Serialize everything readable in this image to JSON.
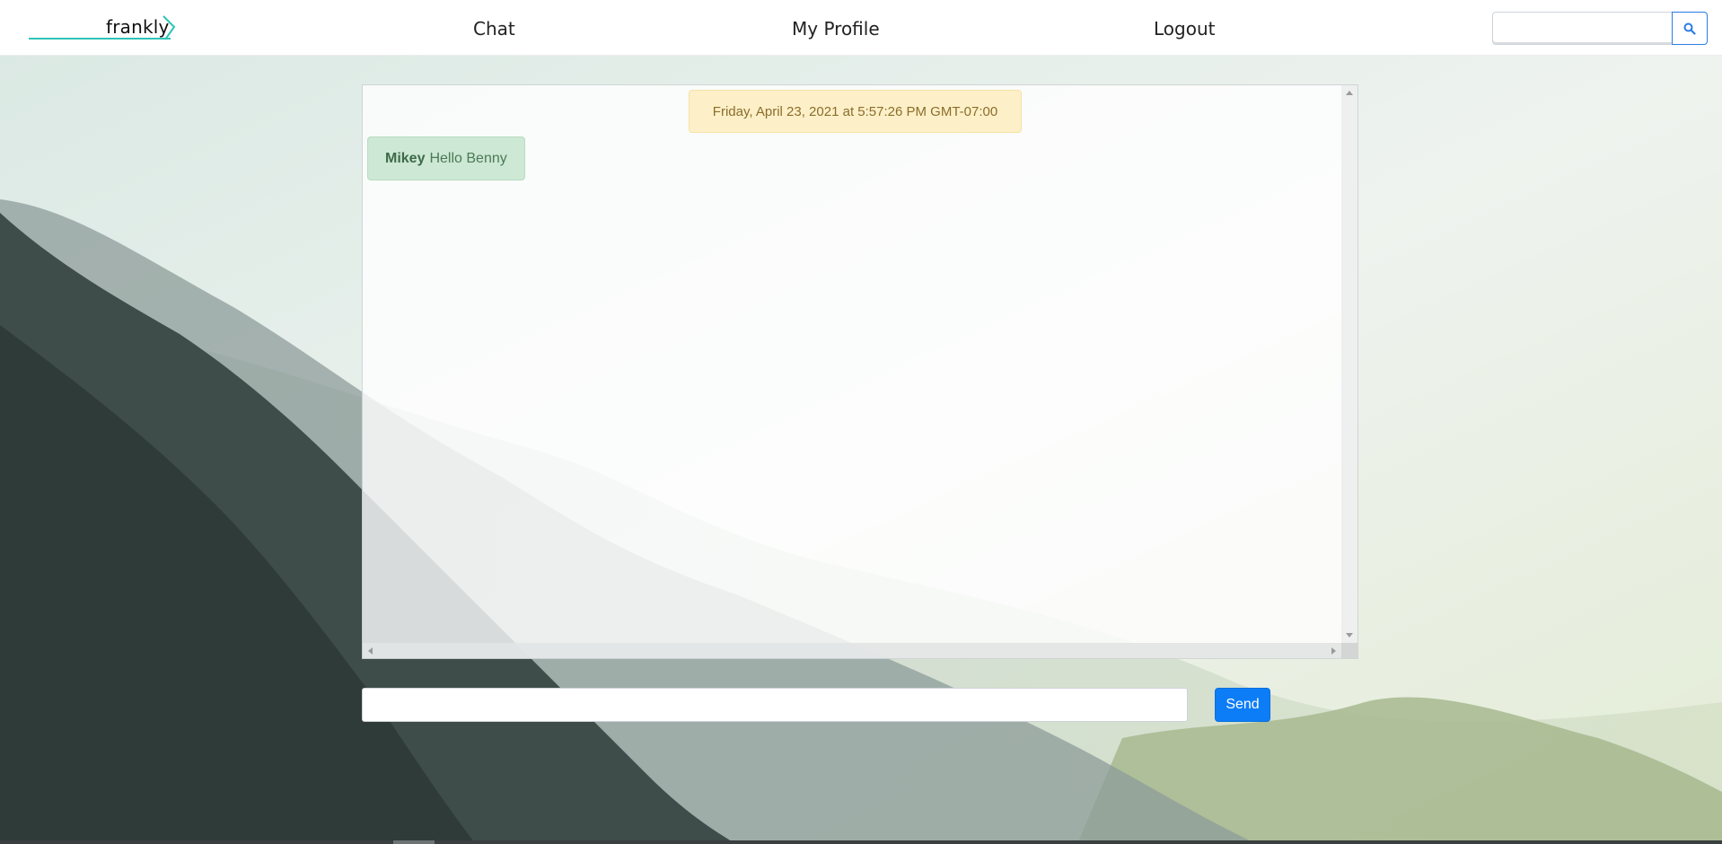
{
  "navbar": {
    "brand": "frankly",
    "links": [
      "Chat",
      "My Profile",
      "Logout"
    ],
    "search_placeholder": "",
    "search_icon": "search-icon"
  },
  "chat": {
    "date_label": "Friday, April 23, 2021 at 5:57:26 PM GMT-07:00",
    "messages": [
      {
        "user": "Mikey",
        "text": "Hello Benny"
      }
    ]
  },
  "composer": {
    "placeholder": "",
    "send_label": "Send"
  },
  "colors": {
    "accent": "#0d7df7",
    "brand_line": "#2ec4b6",
    "date_badge": "#fdf0c8",
    "message_bubble": "#cde8d4"
  }
}
